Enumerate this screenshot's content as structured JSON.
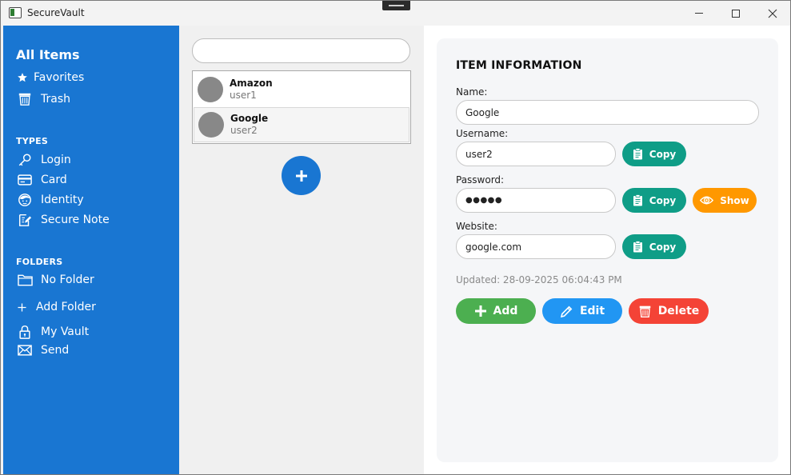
{
  "window": {
    "title": "SecureVault"
  },
  "sidebar": {
    "all_items": "All Items",
    "favorites": "Favorites",
    "trash": "Trash",
    "types_heading": "TYPES",
    "types": [
      "Login",
      "Card",
      "Identity",
      "Secure Note"
    ],
    "folders_heading": "FOLDERS",
    "no_folder": "No Folder",
    "add_folder": "Add Folder",
    "my_vault": "My Vault",
    "send": "Send"
  },
  "search": {
    "placeholder": "",
    "value": ""
  },
  "list": {
    "items": [
      {
        "name": "Amazon",
        "username": "user1"
      },
      {
        "name": "Google",
        "username": "user2"
      }
    ],
    "add_button": "+"
  },
  "detail": {
    "heading": "ITEM INFORMATION",
    "name_label": "Name:",
    "name_value": "Google",
    "username_label": "Username:",
    "username_value": "user2",
    "password_label": "Password:",
    "password_value": "●●●●●",
    "website_label": "Website:",
    "website_value": "google.com",
    "copy_label": "Copy",
    "show_label": "Show",
    "updated": "Updated: 28-09-2025 06:04:43 PM",
    "add_label": "Add",
    "edit_label": "Edit",
    "delete_label": "Delete"
  },
  "colors": {
    "sidebar": "#1976d2",
    "copy": "#0f9d87",
    "show": "#ff9800",
    "add": "#4caf50",
    "edit": "#2196f3",
    "delete": "#f44336"
  }
}
